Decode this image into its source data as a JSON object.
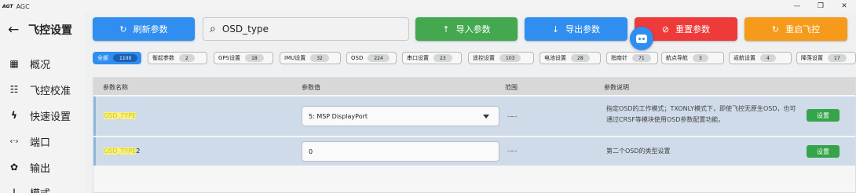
{
  "window": {
    "logo": "AGT",
    "title": "AGC",
    "controls": [
      "—",
      "❐",
      "✕"
    ]
  },
  "sidebar": {
    "back_icon": "back-arrow-icon",
    "title": "飞控设置",
    "items": [
      {
        "icon": "grid-icon",
        "label": "概况"
      },
      {
        "icon": "sliders-icon",
        "label": "飞控校准"
      },
      {
        "icon": "bolt-icon",
        "label": "快速设置"
      },
      {
        "icon": "port-icon",
        "label": "端口"
      },
      {
        "icon": "gear-icon",
        "label": "输出"
      },
      {
        "icon": "mode-icon",
        "label": "模式"
      }
    ]
  },
  "toolbar": {
    "refresh_label": "刷新参数",
    "search_value": "OSD_type",
    "import_label": "导入参数",
    "export_label": "导出参数",
    "reset_label": "重置参数",
    "reboot_label": "重启飞控",
    "colors": {
      "blue": "#2f8ef0",
      "green": "#43a84f",
      "red": "#ef3a3a",
      "orange": "#f59a1a"
    }
  },
  "chips": [
    {
      "label": "全部",
      "count": "1100",
      "active": true
    },
    {
      "label": "衡起参数",
      "count": "2"
    },
    {
      "label": "GPS设置",
      "count": "18"
    },
    {
      "label": "IMU设置",
      "count": "32"
    },
    {
      "label": "OSD",
      "count": "224"
    },
    {
      "label": "串口设置",
      "count": "23"
    },
    {
      "label": "遥控设置",
      "count": "103"
    },
    {
      "label": "电池设置",
      "count": "28"
    },
    {
      "label": "指南针",
      "count": "71"
    },
    {
      "label": "航点导航",
      "count": "3"
    },
    {
      "label": "返航设置",
      "count": "4"
    },
    {
      "label": "降落设置",
      "count": "17"
    }
  ],
  "table": {
    "headers": [
      "参数名称",
      "参数值",
      "范围",
      "参数说明"
    ],
    "rows": [
      {
        "name_hl": "OSD_TYPE",
        "name_rest": "",
        "value": "5: MSP DisplayPort",
        "range": "-~-",
        "desc": "指定OSD的工作模式；TXONLY模式下，即使飞控无原生OSD，也可通过CRSF等模块使用OSD参数配置功能。",
        "button": "设置"
      },
      {
        "name_hl": "OSD_TYPE",
        "name_rest": "2",
        "value": "0",
        "range": "-~-",
        "desc": "第二个OSD的类型设置",
        "button": "设置"
      }
    ]
  }
}
